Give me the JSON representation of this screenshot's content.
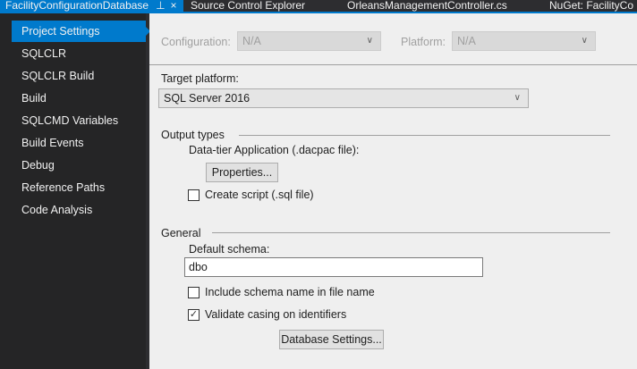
{
  "tabs": [
    {
      "label": "FacilityConfigurationDatabase",
      "active": true
    },
    {
      "label": "Source Control Explorer"
    },
    {
      "label": "OrleansManagementController.cs"
    },
    {
      "label": "NuGet: FacilityCo"
    }
  ],
  "sidebar": {
    "items": [
      {
        "label": "Project Settings",
        "selected": true
      },
      {
        "label": "SQLCLR"
      },
      {
        "label": "SQLCLR Build"
      },
      {
        "label": "Build"
      },
      {
        "label": "SQLCMD Variables"
      },
      {
        "label": "Build Events"
      },
      {
        "label": "Debug"
      },
      {
        "label": "Reference Paths"
      },
      {
        "label": "Code Analysis"
      }
    ]
  },
  "config": {
    "configuration_label": "Configuration:",
    "configuration_value": "N/A",
    "platform_label": "Platform:",
    "platform_value": "N/A"
  },
  "target": {
    "label": "Target platform:",
    "value": "SQL Server 2016"
  },
  "output": {
    "heading": "Output types",
    "dacpac_label": "Data-tier Application (.dacpac file):",
    "properties_button": "Properties...",
    "create_script_label": "Create script (.sql file)",
    "create_script_checked": false
  },
  "general": {
    "heading": "General",
    "schema_label": "Default schema:",
    "schema_value": "dbo",
    "include_schema_label": "Include schema name in file name",
    "include_schema_checked": false,
    "validate_casing_label": "Validate casing on identifiers",
    "validate_casing_checked": true,
    "db_settings_button": "Database Settings..."
  },
  "colors": {
    "accent": "#007acc",
    "sidebar_bg": "#252526",
    "content_bg": "#efefef"
  }
}
